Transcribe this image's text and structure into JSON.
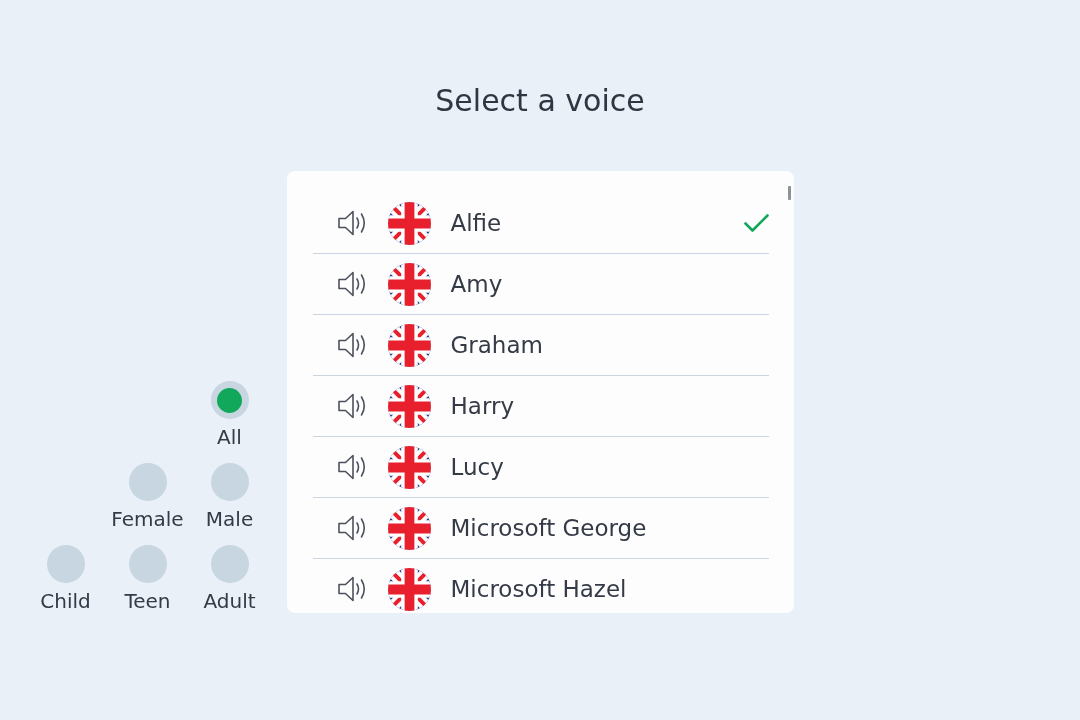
{
  "title": "Select a voice",
  "filter_rows": [
    {
      "options": [
        {
          "label": "All",
          "selected": true
        }
      ]
    },
    {
      "options": [
        {
          "label": "Female",
          "selected": false
        },
        {
          "label": "Male",
          "selected": false
        }
      ]
    },
    {
      "options": [
        {
          "label": "Child",
          "selected": false
        },
        {
          "label": "Teen",
          "selected": false
        },
        {
          "label": "Adult",
          "selected": false
        }
      ]
    }
  ],
  "voices": [
    {
      "name": "Alfie",
      "selected": true
    },
    {
      "name": "Amy",
      "selected": false
    },
    {
      "name": "Graham",
      "selected": false
    },
    {
      "name": "Harry",
      "selected": false
    },
    {
      "name": "Lucy",
      "selected": false
    },
    {
      "name": "Microsoft George",
      "selected": false
    },
    {
      "name": "Microsoft Hazel",
      "selected": false
    }
  ]
}
